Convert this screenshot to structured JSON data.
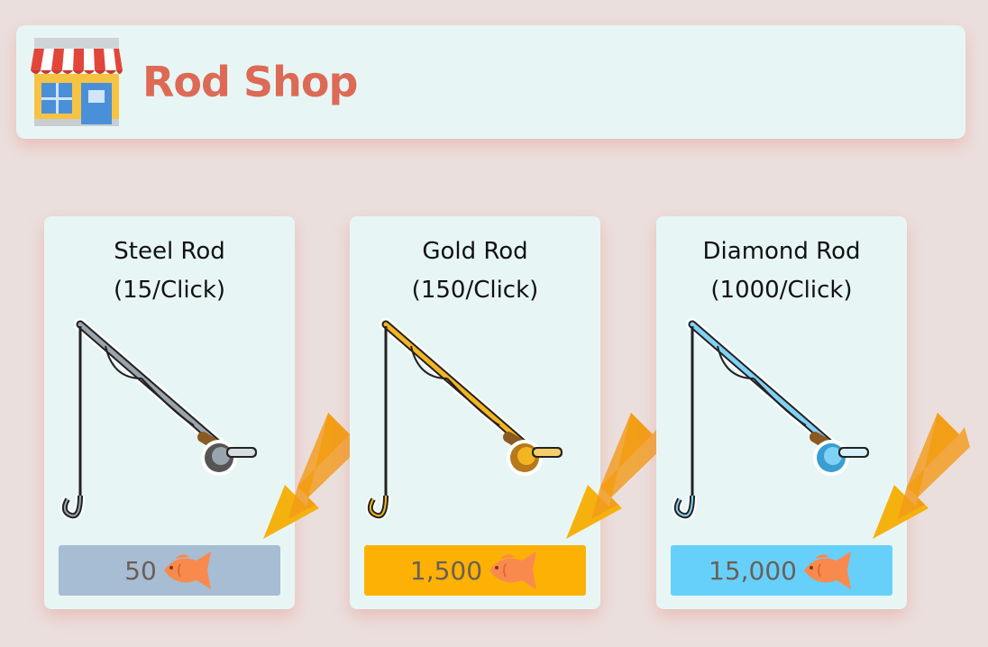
{
  "header": {
    "title": "Rod Shop",
    "icon": "shop-icon"
  },
  "rods": [
    {
      "name": "Steel Rod",
      "rate": "(15/Click)",
      "price": "50",
      "color": "#a6bdd4",
      "accent": "#9aa4ad"
    },
    {
      "name": "Gold Rod",
      "rate": "(150/Click)",
      "price": "1,500",
      "color": "#fdb104",
      "accent": "#f3b521"
    },
    {
      "name": "Diamond Rod",
      "rate": "(1000/Click)",
      "price": "15,000",
      "color": "#66d0fb",
      "accent": "#7fd2f5"
    }
  ],
  "icons": {
    "rod": "fishing-rod-icon",
    "currency": "fish-icon",
    "pointer": "down-left-arrow-icon"
  },
  "colors": {
    "background": "#ebdfdd",
    "panel": "#e7f6f5",
    "title": "#dd6a55",
    "arrow": "#f5b10d",
    "fish": "#f98a4e"
  }
}
